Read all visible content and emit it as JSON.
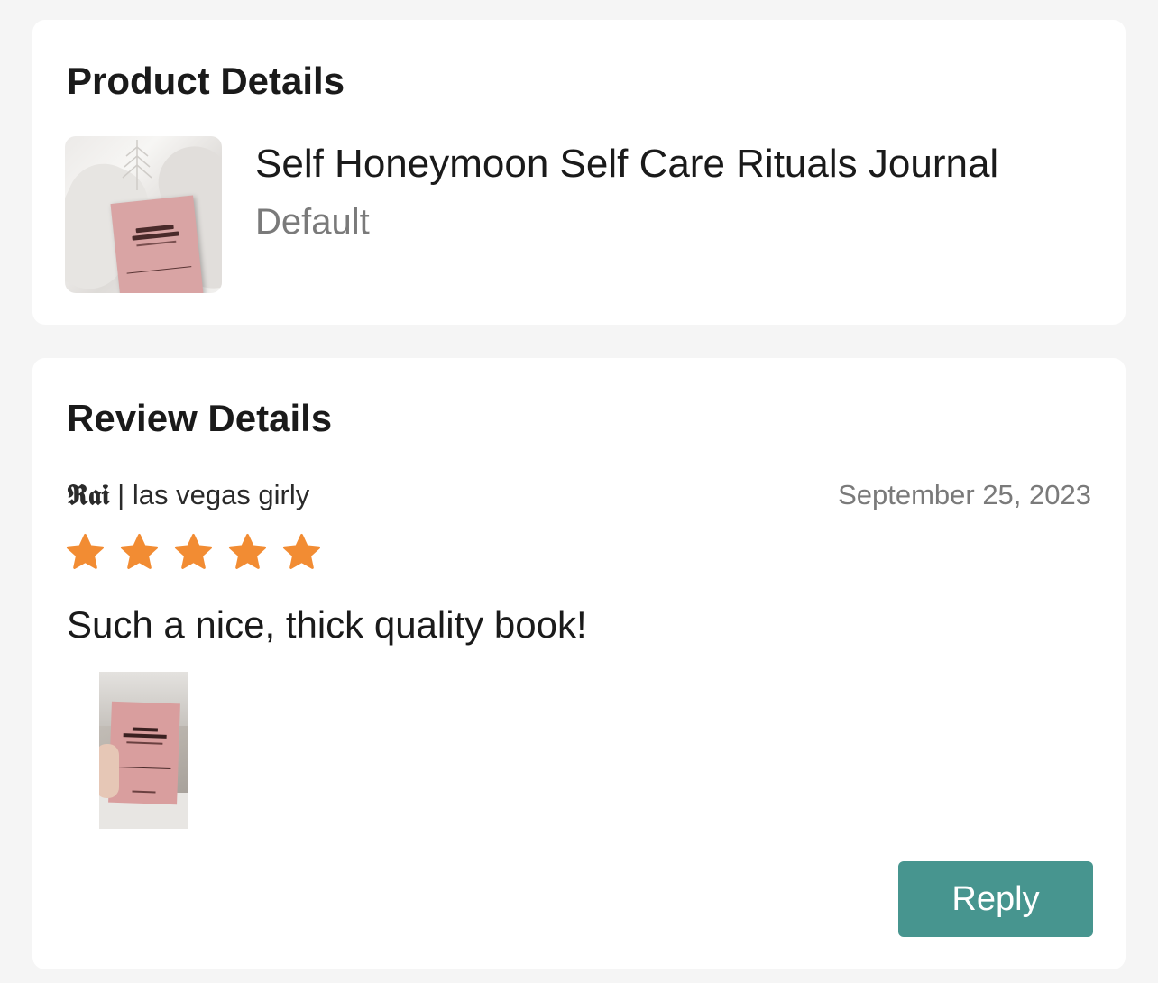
{
  "product_details": {
    "title": "Product Details",
    "product_name": "Self Honeymoon Self Care Rituals Journal",
    "variant": "Default",
    "thumbnail_icon": "product-photo-pink-journal-on-bed"
  },
  "review_details": {
    "title": "Review Details",
    "reviewer_handle": "𝕽𝖆𝖎",
    "reviewer_suffix": " | las vegas girly",
    "date": "September 25, 2023",
    "rating": 5,
    "rating_max": 5,
    "star_color": "#f28c33",
    "review_text": "Such a nice, thick quality book!",
    "photo_icon": "review-photo-hand-holding-pink-journal",
    "reply_label": "Reply",
    "reply_color": "#47958f"
  }
}
